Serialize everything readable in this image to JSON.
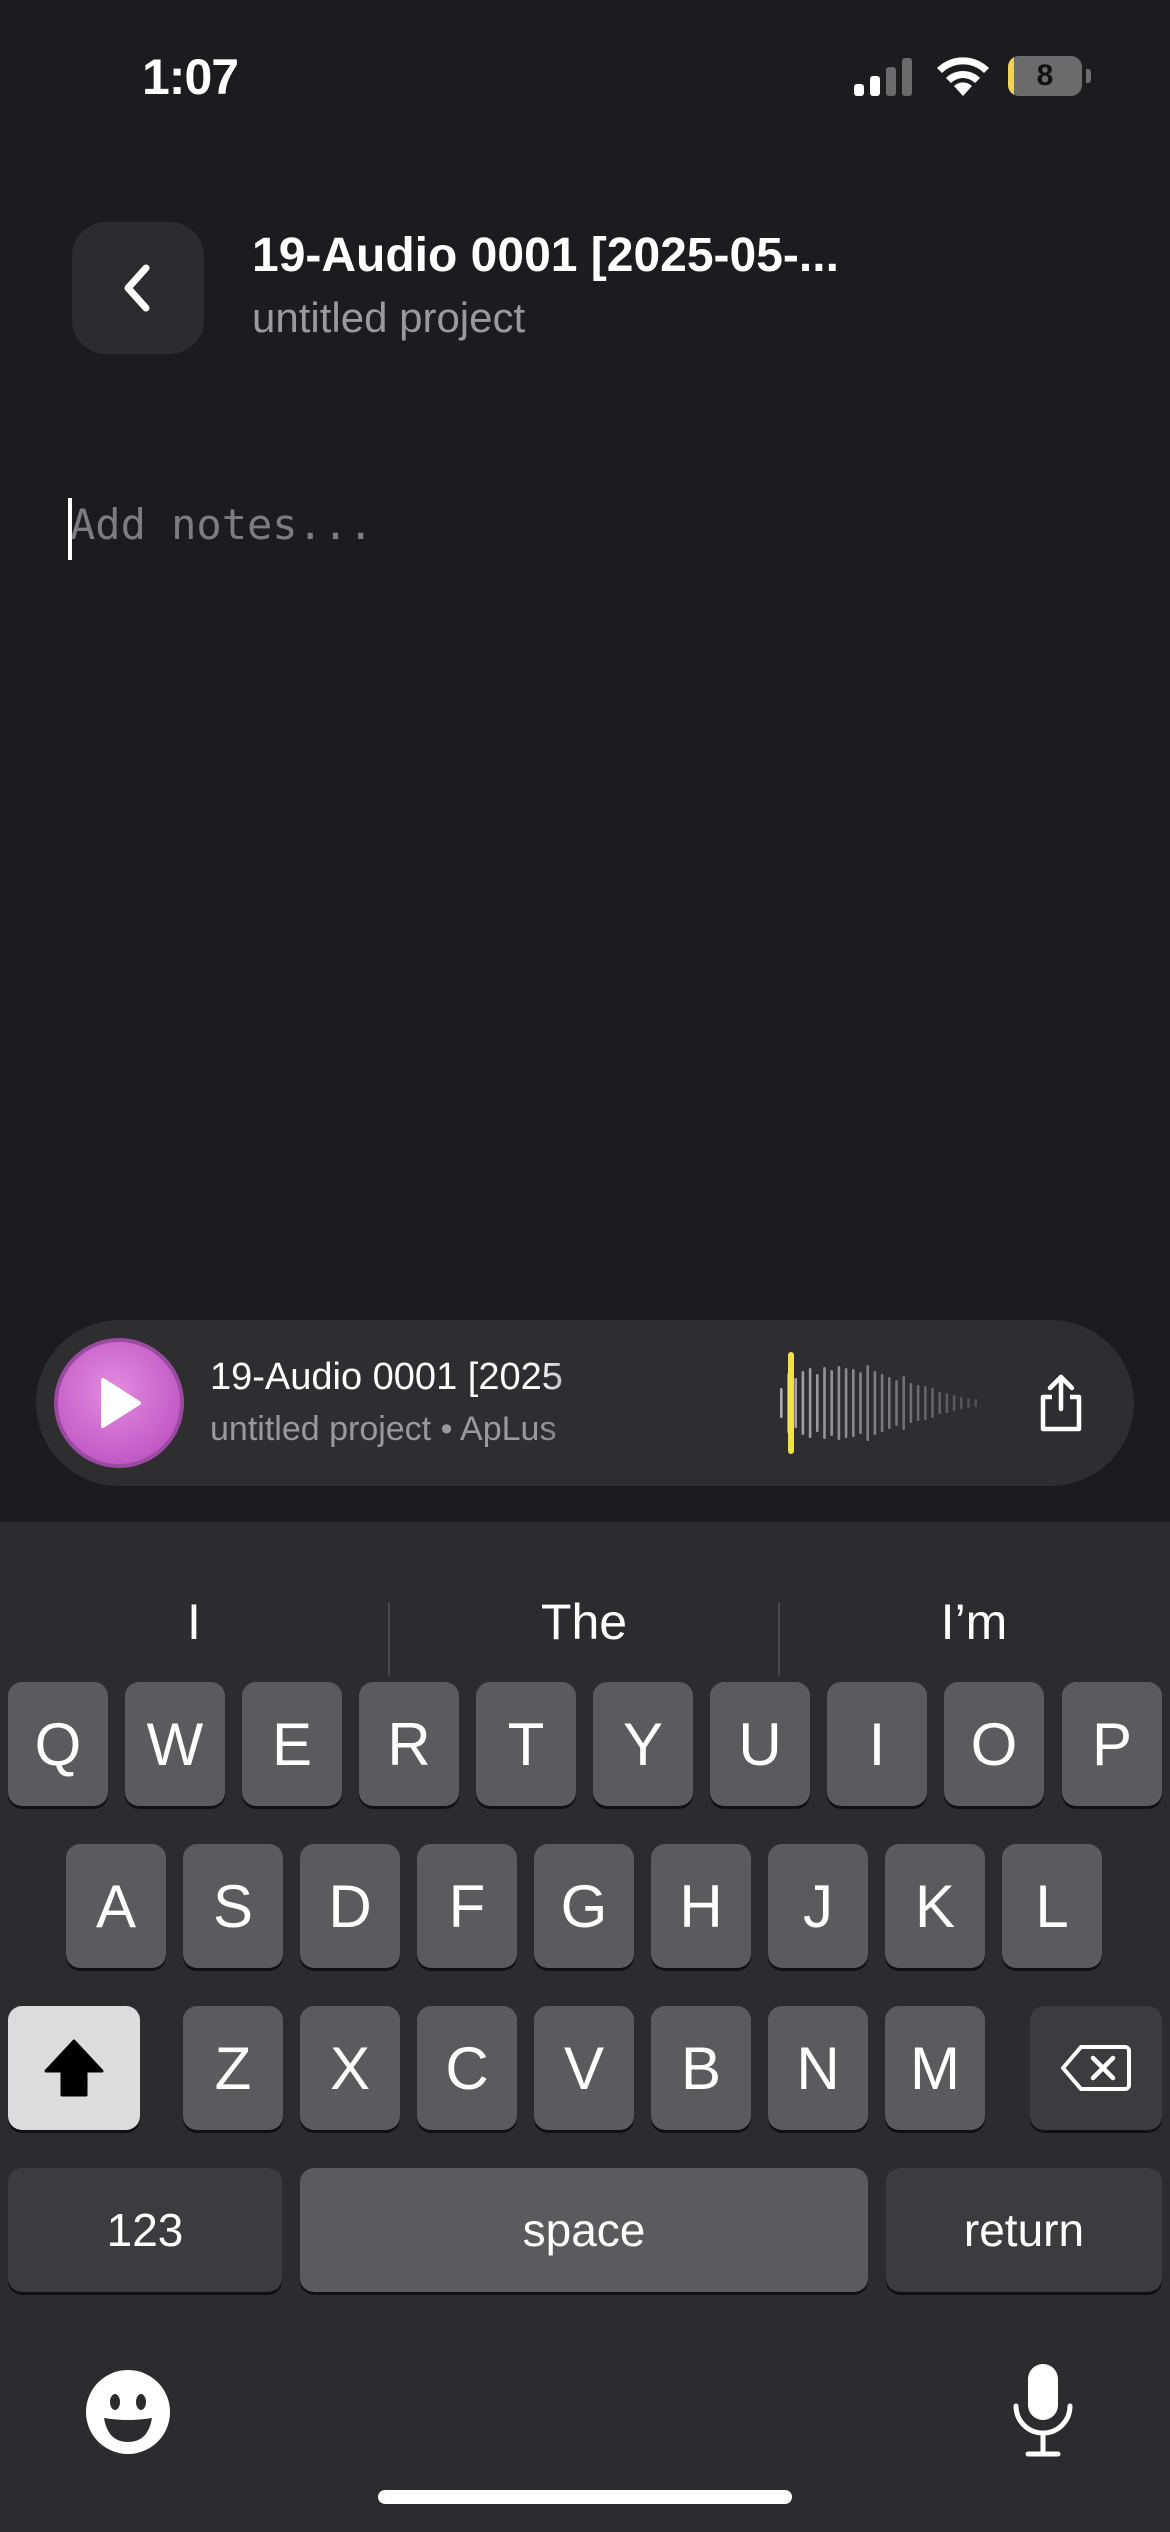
{
  "status_bar": {
    "time": "1:07",
    "battery_level": "8",
    "battery_fill_fraction": 0.08,
    "battery_fill_color": "#f0d34f",
    "signal_bars_active": 2,
    "icons": [
      "signal-icon",
      "wifi-icon",
      "battery-icon"
    ]
  },
  "header": {
    "back_icon": "chevron-left-icon",
    "title": "19-Audio 0001 [2025-05-...",
    "subtitle": "untitled project"
  },
  "notes": {
    "placeholder": "Add notes...",
    "value": ""
  },
  "player": {
    "play_icon": "play-icon",
    "title": "19-Audio 0001 [2025",
    "subtitle": "untitled project • ApLus",
    "playhead_color": "#f0e04a",
    "accent_color": "#c45bc6",
    "share_icon": "share-icon"
  },
  "keyboard": {
    "suggestions": [
      "I",
      "The",
      "I’m"
    ],
    "row1": [
      "Q",
      "W",
      "E",
      "R",
      "T",
      "Y",
      "U",
      "I",
      "O",
      "P"
    ],
    "row2": [
      "A",
      "S",
      "D",
      "F",
      "G",
      "H",
      "J",
      "K",
      "L"
    ],
    "row3": [
      "Z",
      "X",
      "C",
      "V",
      "B",
      "N",
      "M"
    ],
    "numbers_key": "123",
    "space_key": "space",
    "return_key": "return",
    "icons": [
      "shift-icon",
      "delete-icon",
      "emoji-icon",
      "microphone-icon"
    ]
  }
}
